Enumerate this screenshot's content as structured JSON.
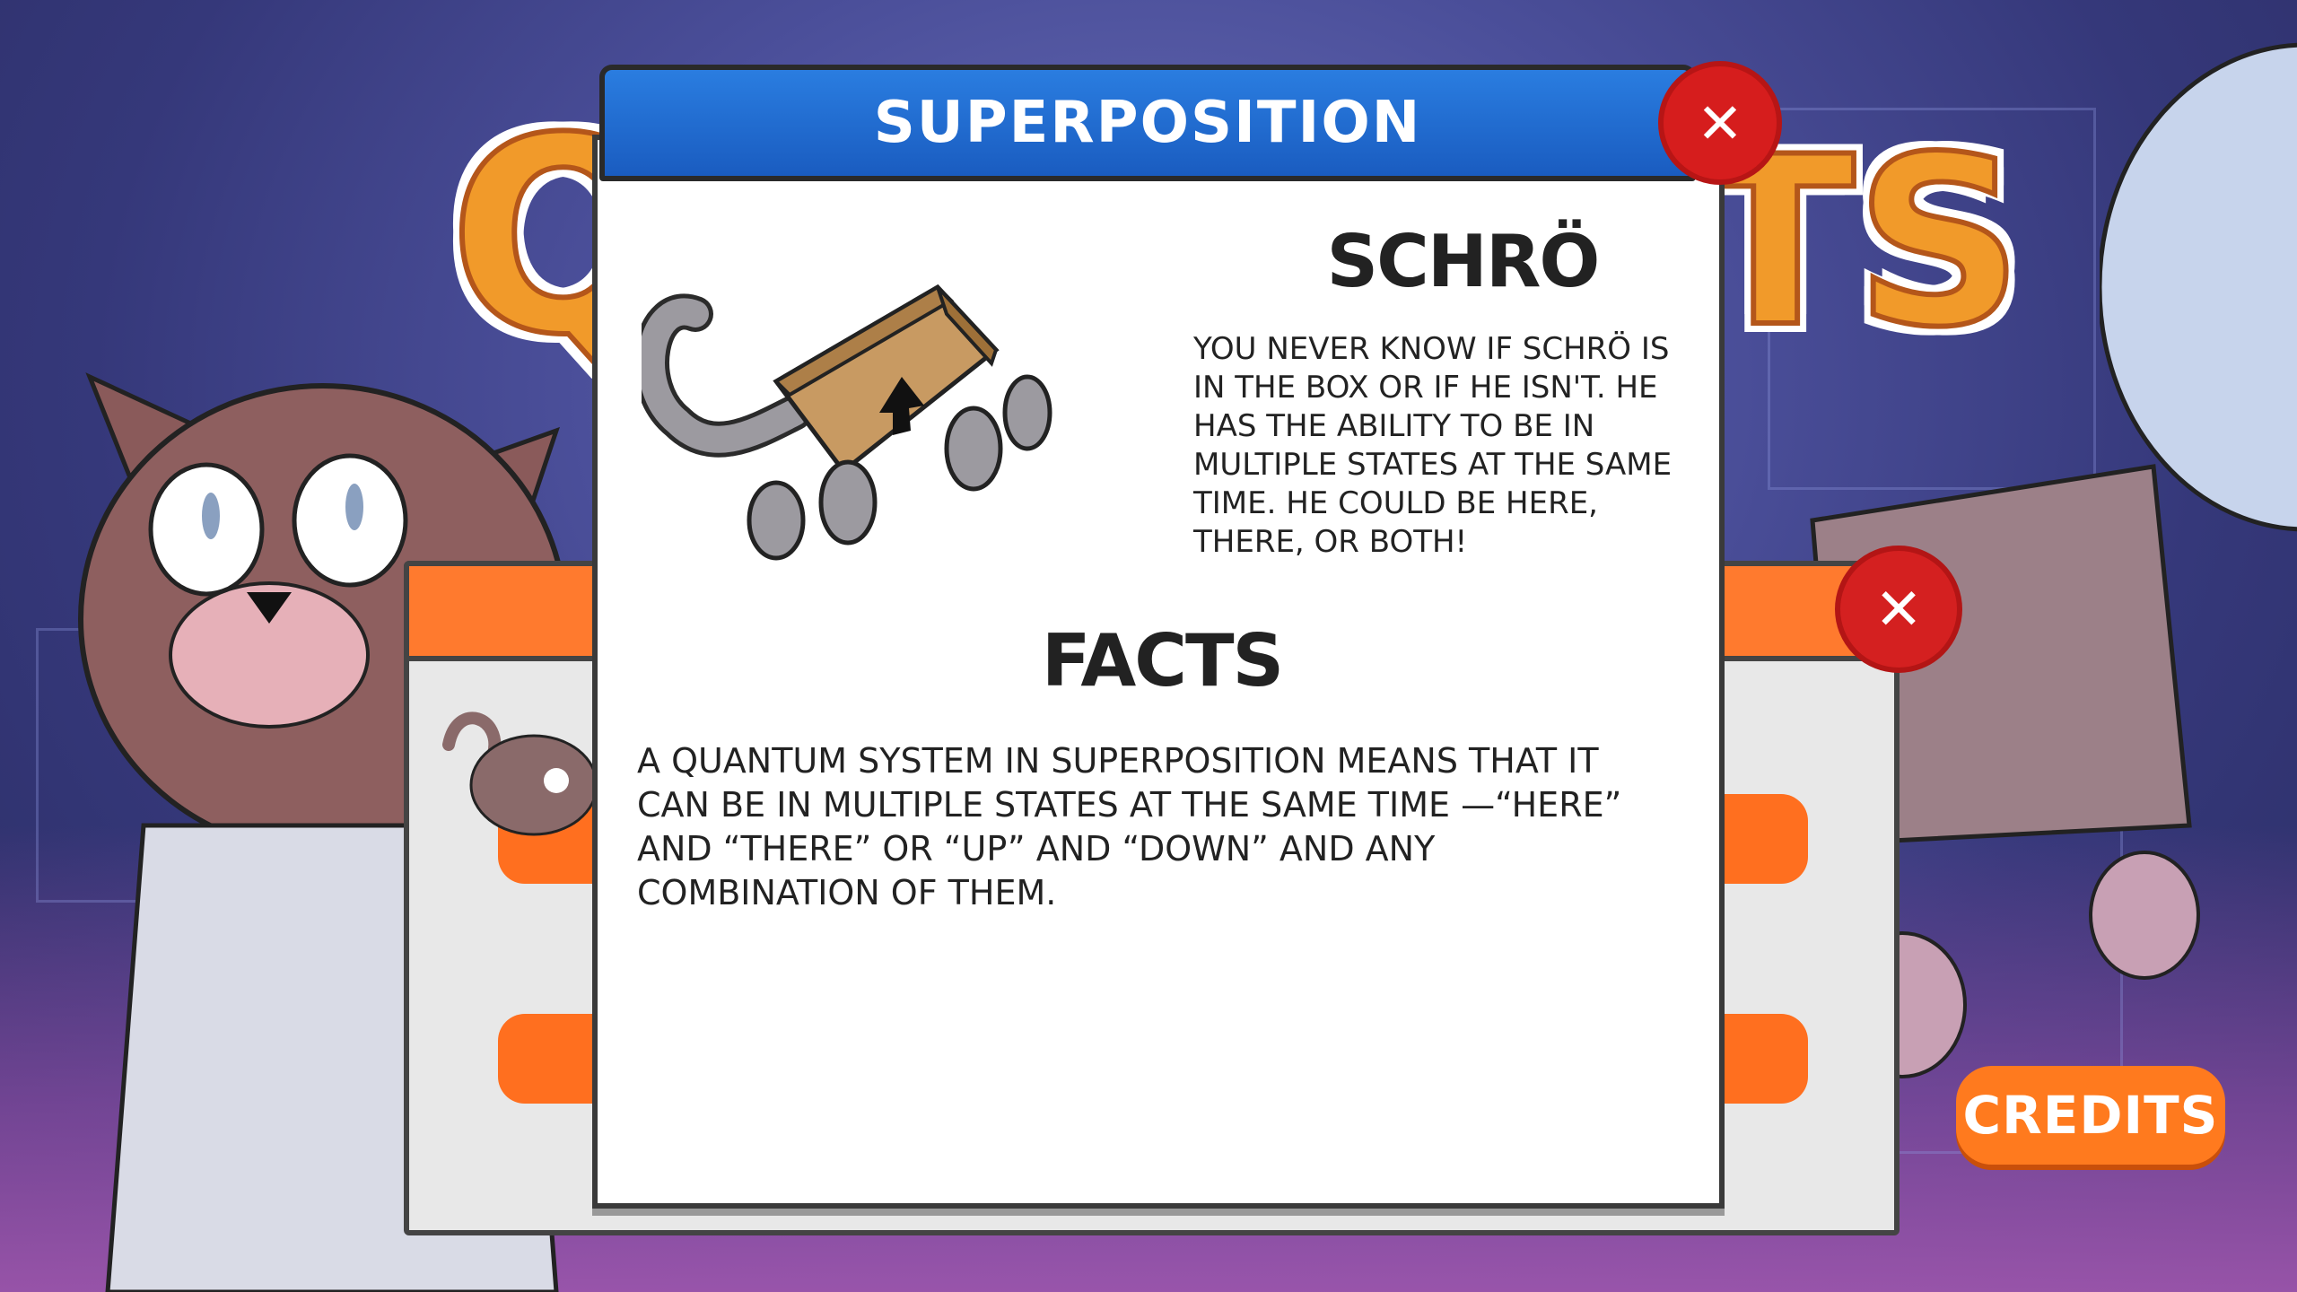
{
  "game": {
    "title_left_letter": "Q",
    "title_right_letters": "TS"
  },
  "background_menu": {
    "close_symbol": "✕"
  },
  "credits_button": {
    "label": "CREDITS"
  },
  "dialog": {
    "title": "SUPERPOSITION",
    "close_symbol": "✕",
    "character_name": "SCHRÖ",
    "character_description": "YOU NEVER KNOW IF SCHRÖ IS IN THE BOX OR IF HE ISN'T. HE HAS THE ABILITY TO BE IN MULTIPLE STATES AT THE SAME TIME. HE COULD BE HERE, THERE, OR BOTH!",
    "facts_heading": "FACTS",
    "facts_text": "A QUANTUM SYSTEM IN SUPERPOSITION MEANS THAT IT CAN BE IN MULTIPLE STATES AT THE SAME TIME —“HERE” AND “THERE” OR “UP” AND “DOWN” AND ANY COMBINATION OF THEM."
  },
  "colors": {
    "header_blue": "#1f6bd6",
    "close_red": "#d61d1d",
    "accent_orange": "#ff7a1e"
  },
  "icons": {
    "character_illustration": "cat-in-box-illustration",
    "close": "close-x-icon"
  }
}
